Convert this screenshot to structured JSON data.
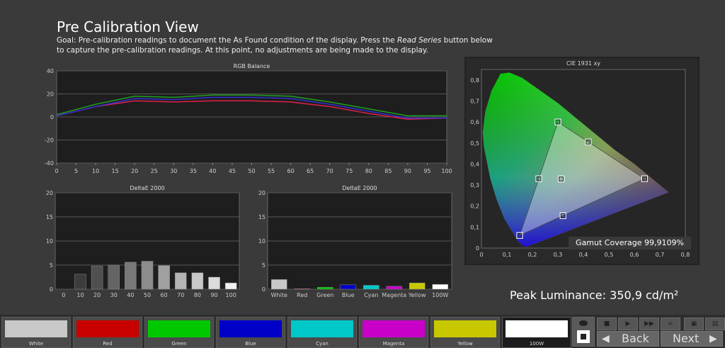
{
  "page": {
    "title": "Pre Calibration View",
    "goal_part1": "Goal: Pre-calibration readings to document the As Found condition of the display. Press the ",
    "goal_emph": "Read Series",
    "goal_part2": " button below to capture the pre-calibration readings. At this point, no adjustments are being made to the display."
  },
  "rgb_chart": {
    "title": "RGB Balance",
    "x_ticks": [
      "0",
      "5",
      "10",
      "15",
      "20",
      "25",
      "30",
      "35",
      "40",
      "45",
      "50",
      "55",
      "60",
      "65",
      "70",
      "75",
      "80",
      "85",
      "90",
      "95",
      "100"
    ],
    "y_ticks": [
      "40",
      "20",
      "0",
      "-20",
      "-40"
    ]
  },
  "delta_chart_1": {
    "title": "DeltaE 2000",
    "y_ticks": [
      "20",
      "15",
      "10",
      "5",
      "0"
    ],
    "categories": [
      "0",
      "10",
      "20",
      "30",
      "40",
      "50",
      "60",
      "70",
      "80",
      "90",
      "100"
    ]
  },
  "delta_chart_2": {
    "title": "DeltaE 2000",
    "y_ticks": [
      "20",
      "15",
      "10",
      "5",
      "0"
    ],
    "categories": [
      "White",
      "Red",
      "Green",
      "Blue",
      "Cyan",
      "Magenta",
      "Yellow",
      "100W"
    ]
  },
  "cie_chart": {
    "title": "CIE 1931 xy",
    "x_ticks": [
      "0",
      "0,1",
      "0,2",
      "0,3",
      "0,4",
      "0,5",
      "0,6",
      "0,7",
      "0,8"
    ],
    "y_ticks": [
      "0,8",
      "0,7",
      "0,6",
      "0,5",
      "0,4",
      "0,3",
      "0,2",
      "0,1",
      "0"
    ]
  },
  "gamut_coverage": "Gamut Coverage 99,9109%",
  "peak_luminance": "Peak Luminance: 350,9 cd/m²",
  "swatches": [
    {
      "label": "White",
      "color": "#c8c8c8"
    },
    {
      "label": "Red",
      "color": "#c80000"
    },
    {
      "label": "Green",
      "color": "#00c800"
    },
    {
      "label": "Blue",
      "color": "#0000c8"
    },
    {
      "label": "Cyan",
      "color": "#00c8c8"
    },
    {
      "label": "Magenta",
      "color": "#c800c8"
    },
    {
      "label": "Yellow",
      "color": "#c8c800"
    },
    {
      "label": "100W",
      "color": "#ffffff"
    }
  ],
  "nav": {
    "back": "Back",
    "next": "Next"
  },
  "chart_data": [
    {
      "type": "line",
      "title": "RGB Balance",
      "x": [
        0,
        10,
        20,
        30,
        40,
        50,
        60,
        70,
        80,
        90,
        100
      ],
      "series": [
        {
          "name": "Red",
          "color": "#e0204a",
          "values": [
            1,
            9,
            14,
            13,
            14,
            14,
            13,
            9,
            3,
            -2,
            -1
          ]
        },
        {
          "name": "Green",
          "color": "#20a020",
          "values": [
            2,
            11,
            18,
            17,
            19,
            19,
            18,
            13,
            7,
            1,
            1
          ]
        },
        {
          "name": "Blue",
          "color": "#3030d0",
          "values": [
            1,
            9,
            16,
            15,
            17,
            17,
            16,
            11,
            5,
            -1,
            -1
          ]
        }
      ],
      "xlim": [
        0,
        100
      ],
      "ylim": [
        -40,
        40
      ]
    },
    {
      "type": "bar",
      "title": "DeltaE 2000",
      "categories": [
        "0",
        "10",
        "20",
        "30",
        "40",
        "50",
        "60",
        "70",
        "80",
        "90",
        "100"
      ],
      "values": [
        0,
        3.1,
        4.8,
        5.0,
        5.6,
        5.8,
        4.9,
        3.4,
        3.4,
        2.5,
        1.3
      ],
      "ylim": [
        0,
        20
      ]
    },
    {
      "type": "bar",
      "title": "DeltaE 2000",
      "categories": [
        "White",
        "Red",
        "Green",
        "Blue",
        "Cyan",
        "Magenta",
        "Yellow",
        "100W"
      ],
      "values": [
        2.0,
        0.1,
        0.4,
        0.9,
        0.8,
        0.6,
        1.3,
        1.0
      ],
      "colors": [
        "#c8c8c8",
        "#c80000",
        "#00c800",
        "#0000c8",
        "#00c8c8",
        "#c800c8",
        "#c8c800",
        "#ffffff"
      ],
      "ylim": [
        0,
        20
      ]
    },
    {
      "type": "scatter",
      "title": "CIE 1931 xy",
      "gamut_triangle": [
        [
          0.64,
          0.33
        ],
        [
          0.3,
          0.6
        ],
        [
          0.15,
          0.06
        ]
      ],
      "measured_points": [
        [
          0.64,
          0.33
        ],
        [
          0.3,
          0.6
        ],
        [
          0.15,
          0.06
        ],
        [
          0.225,
          0.33
        ],
        [
          0.3127,
          0.329
        ],
        [
          0.32,
          0.154
        ],
        [
          0.419,
          0.505
        ]
      ],
      "xlim": [
        0,
        0.8
      ],
      "ylim": [
        0,
        0.85
      ]
    }
  ]
}
